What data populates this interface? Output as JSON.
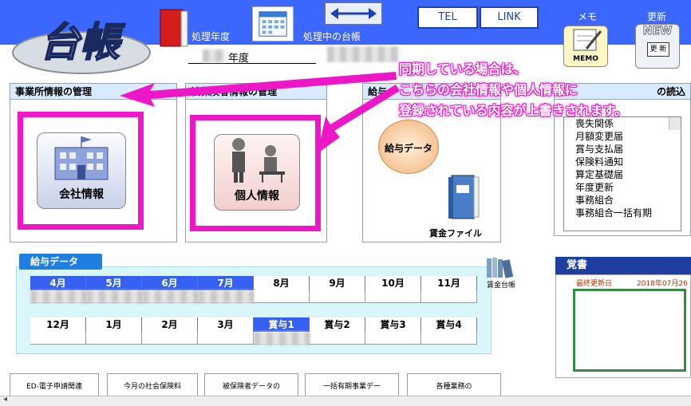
{
  "header": {
    "logo_text": "台帳",
    "label_year": "処理年度",
    "label_ledger": "処理中の台帳",
    "year_suffix": "年度",
    "btn_tel": "TEL",
    "btn_link": "LINK",
    "memo_label": "メモ",
    "update_label": "更新",
    "memo_icon_text": "MEMO",
    "new_text": "NEW",
    "update_icon_text": "更 新"
  },
  "panels": {
    "company_mgmt": "事業所情報の管理",
    "insured_mgmt": "被保険者情報の管理",
    "salary_head": "給与",
    "import_head": "の読込",
    "company_btn": "会社情報",
    "person_btn": "個人情報",
    "salary_data_btn": "給与データ",
    "wage_file": "賃金ファイル"
  },
  "import_list": [
    "喪失関係",
    "月額変更届",
    "賞与支払届",
    "保険料通知",
    "算定基礎届",
    "年度更新",
    "事務組合",
    "事務組合一括有期"
  ],
  "salary": {
    "tab": "給与データ",
    "row1": [
      "4月",
      "5月",
      "6月",
      "7月",
      "8月",
      "9月",
      "10月",
      "11月"
    ],
    "row2": [
      "12月",
      "1月",
      "2月",
      "3月",
      "賞与1",
      "賞与2",
      "賞与3",
      "賞与4"
    ],
    "wage_ledger": "賃金台帳"
  },
  "memo": {
    "title": "覚書",
    "last_updated_label": "最終更新日",
    "last_updated_value": "2018年07月26日"
  },
  "bottom_buttons": [
    "ED-電子申請関連",
    "今月の社会保険料",
    "被保険者データの",
    "一括有期事業デー",
    "各種業務の"
  ],
  "callout": {
    "line1": "同期している場合は、",
    "line2": "こちらの会社情報や個人情報に",
    "line3": "登録されている内容が上書きされます。"
  },
  "colors": {
    "header_blue": "#3c67ff",
    "highlight_pink": "#ee17c8",
    "month_active": "#3560f0",
    "panel_cyan": "#d9f7fb"
  }
}
